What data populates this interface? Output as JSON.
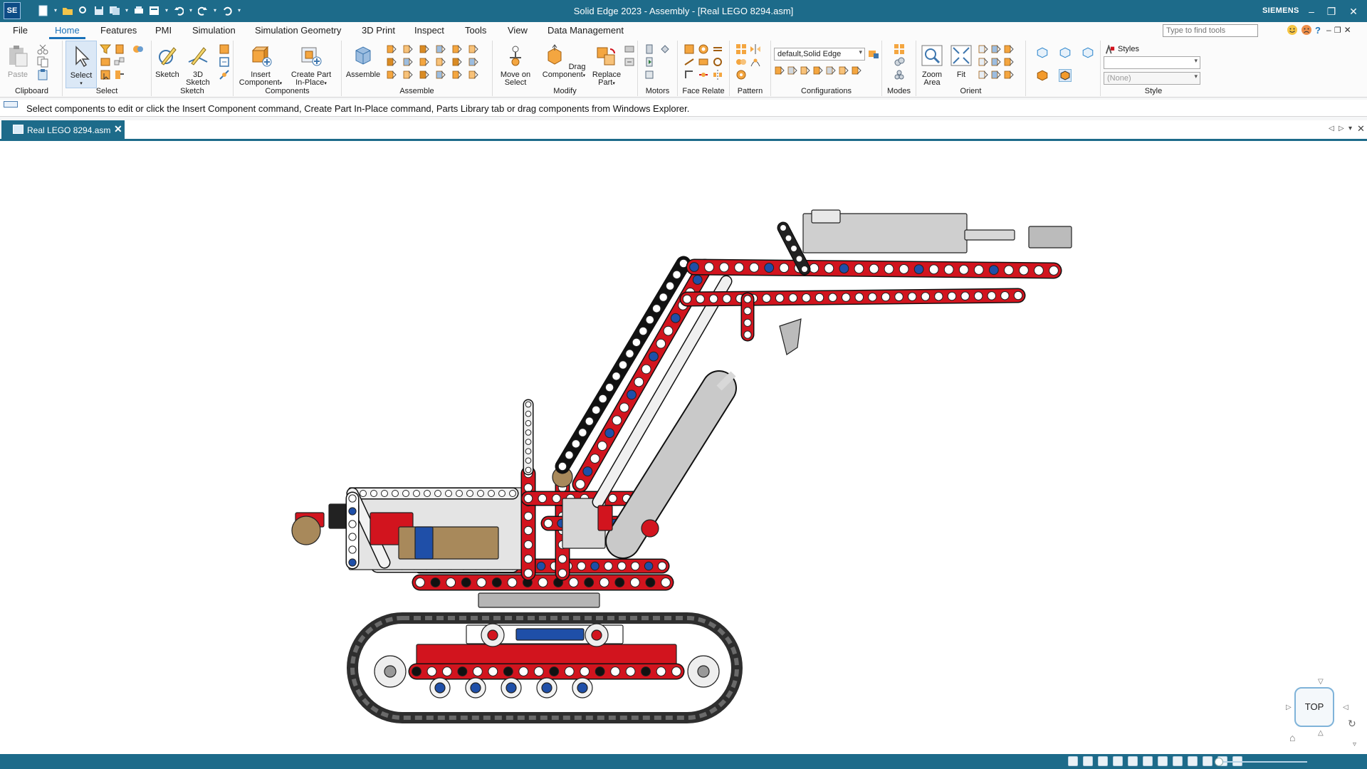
{
  "app": {
    "logo": "SE",
    "window_title": "Solid Edge 2023 - Assembly - [Real LEGO 8294.asm]",
    "brand": "SIEMENS"
  },
  "quick_access": [
    "new-icon",
    "open-icon",
    "save-icon",
    "save-all-icon",
    "print-icon",
    "properties-icon",
    "undo-icon",
    "redo-icon",
    "customize-icon"
  ],
  "tabs": [
    "File",
    "Home",
    "Features",
    "PMI",
    "Simulation",
    "Simulation Geometry",
    "3D Print",
    "Inspect",
    "Tools",
    "View",
    "Data Management"
  ],
  "active_tab": "Home",
  "find_tools_placeholder": "Type to find tools",
  "ribbon": {
    "clipboard": {
      "label": "Clipboard",
      "paste": "Paste"
    },
    "select": {
      "label": "Select",
      "select": "Select"
    },
    "sketch": {
      "label": "Sketch",
      "sketch": "Sketch",
      "sketch3d_a": "3D",
      "sketch3d_b": "Sketch"
    },
    "components": {
      "label": "Components",
      "insert_a": "Insert",
      "insert_b": "Component",
      "create_a": "Create Part",
      "create_b": "In-Place"
    },
    "assemble": {
      "label": "Assemble",
      "assemble": "Assemble"
    },
    "modify": {
      "label": "Modify",
      "move_a": "Move on",
      "move_b": "Select",
      "drag_a": "Drag",
      "drag_b": "Component",
      "replace_a": "Replace",
      "replace_b": "Part"
    },
    "motors": {
      "label": "Motors"
    },
    "face_relate": {
      "label": "Face Relate"
    },
    "pattern": {
      "label": "Pattern"
    },
    "configurations": {
      "label": "Configurations",
      "value": "default,Solid Edge"
    },
    "modes": {
      "label": "Modes"
    },
    "orient": {
      "label": "Orient",
      "zoom_a": "Zoom",
      "zoom_b": "Area",
      "fit": "Fit"
    },
    "style": {
      "label": "Style",
      "styles": "Styles",
      "none": "(None)"
    }
  },
  "prompt": "Select components to edit or click the Insert Component command, Create Part In-Place command, Parts Library tab or drag components from Windows Explorer.",
  "document_tab": "Real LEGO 8294.asm",
  "view_cube": "TOP",
  "colors": {
    "accent": "#1d6b8a",
    "lego_red": "#d2141e",
    "lego_blue": "#1f4fa8",
    "lego_black": "#262626",
    "lego_grey": "#b8b8b8",
    "lego_tan": "#a8895b"
  }
}
